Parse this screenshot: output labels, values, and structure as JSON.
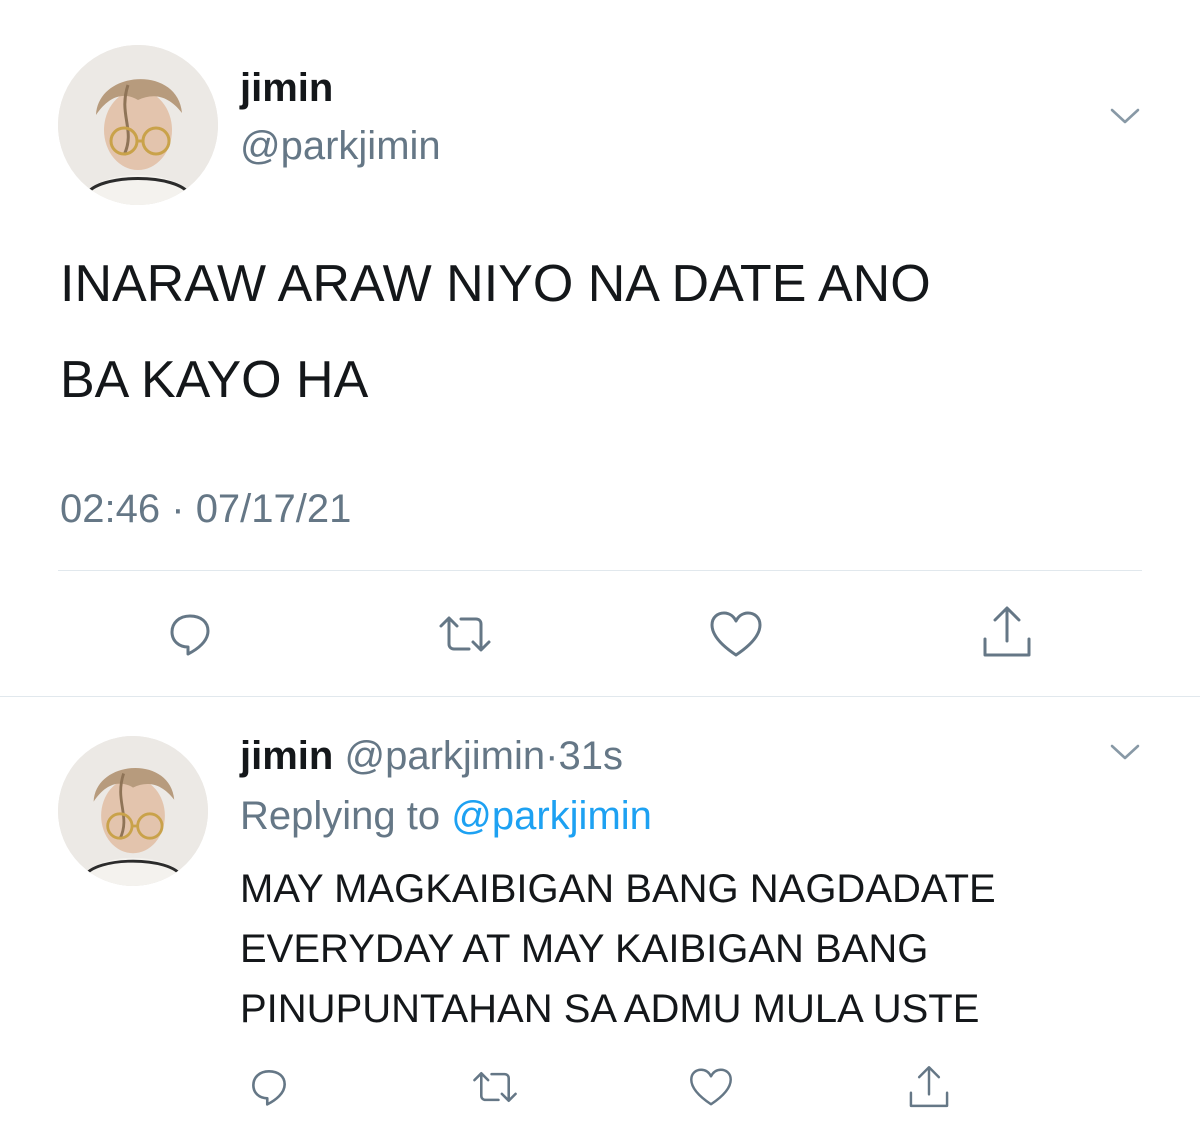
{
  "main_tweet": {
    "author_name": "jimin",
    "author_handle": "@parkjimin",
    "text_line1": "INARAW ARAW NIYO NA DATE ANO",
    "text_line2": "BA KAYO HA",
    "time": "02:46",
    "separator": "·",
    "date": "07/17/21"
  },
  "reply_tweet": {
    "author_name": "jimin",
    "author_handle": "@parkjimin",
    "separator": "·",
    "age": "31s",
    "replying_prefix": "Replying to",
    "replying_handle": "@parkjimin",
    "text_line1": "MAY MAGKAIBIGAN BANG NAGDADATE",
    "text_line2": "EVERYDAY AT MAY KAIBIGAN BANG",
    "text_line3": "PINUPUNTAHAN SA ADMU MULA USTE"
  },
  "icons": {
    "more": "chevron-down-icon",
    "reply": "reply-bubble-icon",
    "retweet": "retweet-icon",
    "like": "heart-icon",
    "share": "share-icon"
  },
  "colors": {
    "text": "#14171a",
    "muted": "#657786",
    "link": "#1da1f2",
    "icon": "#657786",
    "divider": "#e1e8ed"
  }
}
